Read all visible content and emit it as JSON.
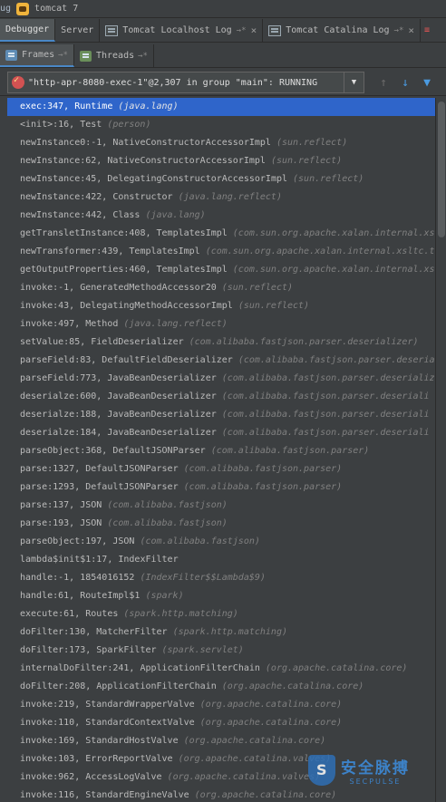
{
  "window": {
    "left_label": "ug",
    "title": "tomcat 7"
  },
  "tabs": [
    {
      "label": "Debugger",
      "active": true
    },
    {
      "label": "Server",
      "active": false
    },
    {
      "label": "Tomcat Localhost Log",
      "pin": "→*",
      "active": false
    },
    {
      "label": "Tomcat Catalina Log",
      "pin": "→*",
      "active": false
    }
  ],
  "subtabs": [
    {
      "label": "Frames",
      "pin": "→*",
      "active": true
    },
    {
      "label": "Threads",
      "pin": "→*",
      "active": false
    }
  ],
  "thread_selector": {
    "value": "\"http-apr-8080-exec-1\"@2,307 in group \"main\": RUNNING",
    "dropdown_icon": "▼"
  },
  "toolbar": {
    "up_icon": "↑",
    "down_icon": "↓",
    "filter_icon": "▼"
  },
  "frames": [
    {
      "method": "exec:347, Runtime",
      "pkg": "(java.lang)",
      "selected": true
    },
    {
      "method": "<init>:16, Test",
      "pkg": "(person)"
    },
    {
      "method": "newInstance0:-1, NativeConstructorAccessorImpl",
      "pkg": "(sun.reflect)"
    },
    {
      "method": "newInstance:62, NativeConstructorAccessorImpl",
      "pkg": "(sun.reflect)"
    },
    {
      "method": "newInstance:45, DelegatingConstructorAccessorImpl",
      "pkg": "(sun.reflect)"
    },
    {
      "method": "newInstance:422, Constructor",
      "pkg": "(java.lang.reflect)"
    },
    {
      "method": "newInstance:442, Class",
      "pkg": "(java.lang)"
    },
    {
      "method": "getTransletInstance:408, TemplatesImpl",
      "pkg": "(com.sun.org.apache.xalan.internal.xslt"
    },
    {
      "method": "newTransformer:439, TemplatesImpl",
      "pkg": "(com.sun.org.apache.xalan.internal.xsltc.tr"
    },
    {
      "method": "getOutputProperties:460, TemplatesImpl",
      "pkg": "(com.sun.org.apache.xalan.internal.xslt"
    },
    {
      "method": "invoke:-1, GeneratedMethodAccessor20",
      "pkg": "(sun.reflect)"
    },
    {
      "method": "invoke:43, DelegatingMethodAccessorImpl",
      "pkg": "(sun.reflect)"
    },
    {
      "method": "invoke:497, Method",
      "pkg": "(java.lang.reflect)"
    },
    {
      "method": "setValue:85, FieldDeserializer",
      "pkg": "(com.alibaba.fastjson.parser.deserializer)"
    },
    {
      "method": "parseField:83, DefaultFieldDeserializer",
      "pkg": "(com.alibaba.fastjson.parser.deseria"
    },
    {
      "method": "parseField:773, JavaBeanDeserializer",
      "pkg": "(com.alibaba.fastjson.parser.deserializ"
    },
    {
      "method": "deserialze:600, JavaBeanDeserializer",
      "pkg": "(com.alibaba.fastjson.parser.deseriali"
    },
    {
      "method": "deserialze:188, JavaBeanDeserializer",
      "pkg": "(com.alibaba.fastjson.parser.deseriali"
    },
    {
      "method": "deserialze:184, JavaBeanDeserializer",
      "pkg": "(com.alibaba.fastjson.parser.deseriali"
    },
    {
      "method": "parseObject:368, DefaultJSONParser",
      "pkg": "(com.alibaba.fastjson.parser)"
    },
    {
      "method": "parse:1327, DefaultJSONParser",
      "pkg": "(com.alibaba.fastjson.parser)"
    },
    {
      "method": "parse:1293, DefaultJSONParser",
      "pkg": "(com.alibaba.fastjson.parser)"
    },
    {
      "method": "parse:137, JSON",
      "pkg": "(com.alibaba.fastjson)"
    },
    {
      "method": "parse:193, JSON",
      "pkg": "(com.alibaba.fastjson)"
    },
    {
      "method": "parseObject:197, JSON",
      "pkg": "(com.alibaba.fastjson)"
    },
    {
      "method": "lambda$init$1:17, IndexFilter",
      "pkg": ""
    },
    {
      "method": "handle:-1, 1854016152",
      "pkg": "(IndexFilter$$Lambda$9)"
    },
    {
      "method": "handle:61, RouteImpl$1",
      "pkg": "(spark)"
    },
    {
      "method": "execute:61, Routes",
      "pkg": "(spark.http.matching)"
    },
    {
      "method": "doFilter:130, MatcherFilter",
      "pkg": "(spark.http.matching)"
    },
    {
      "method": "doFilter:173, SparkFilter",
      "pkg": "(spark.servlet)"
    },
    {
      "method": "internalDoFilter:241, ApplicationFilterChain",
      "pkg": "(org.apache.catalina.core)"
    },
    {
      "method": "doFilter:208, ApplicationFilterChain",
      "pkg": "(org.apache.catalina.core)"
    },
    {
      "method": "invoke:219, StandardWrapperValve",
      "pkg": "(org.apache.catalina.core)"
    },
    {
      "method": "invoke:110, StandardContextValve",
      "pkg": "(org.apache.catalina.core)"
    },
    {
      "method": "invoke:169, StandardHostValve",
      "pkg": "(org.apache.catalina.core)"
    },
    {
      "method": "invoke:103, ErrorReportValve",
      "pkg": "(org.apache.catalina.valves)"
    },
    {
      "method": "invoke:962, AccessLogValve",
      "pkg": "(org.apache.catalina.valves)"
    },
    {
      "method": "invoke:116, StandardEngineValve",
      "pkg": "(org.apache.catalina.core)"
    }
  ],
  "watermark": {
    "cn": "安全脉搏",
    "en": "SECPULSE"
  },
  "colors": {
    "background": "#3c3f41",
    "selection": "#2f65ca",
    "accent": "#4a88c7",
    "package_text": "#808080"
  }
}
